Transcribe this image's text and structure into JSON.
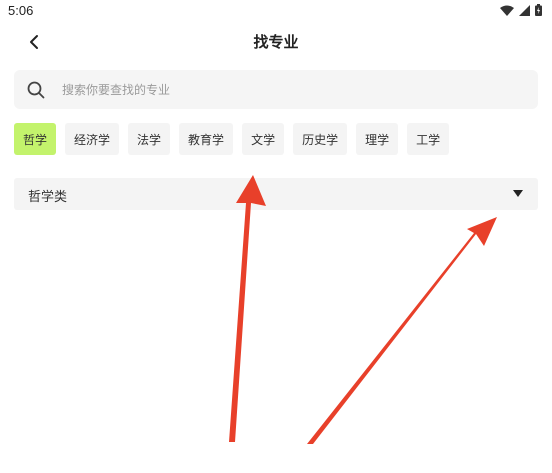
{
  "status_bar": {
    "time": "5:06"
  },
  "header": {
    "title": "找专业",
    "back_icon": "chevron-left-icon"
  },
  "search": {
    "placeholder": "搜索你要查找的专业",
    "value": "",
    "icon": "search-icon"
  },
  "tabs": [
    {
      "label": "哲学",
      "active": true
    },
    {
      "label": "经济学",
      "active": false
    },
    {
      "label": "法学",
      "active": false
    },
    {
      "label": "教育学",
      "active": false
    },
    {
      "label": "文学",
      "active": false
    },
    {
      "label": "历史学",
      "active": false
    },
    {
      "label": "理学",
      "active": false
    },
    {
      "label": "工学",
      "active": false
    }
  ],
  "category": {
    "selected": "哲学类",
    "icon": "caret-down-icon"
  },
  "colors": {
    "active_tab": "#c3f36c",
    "tab_bg": "#f4f4f4",
    "annotation_arrow": "#e8402a"
  }
}
